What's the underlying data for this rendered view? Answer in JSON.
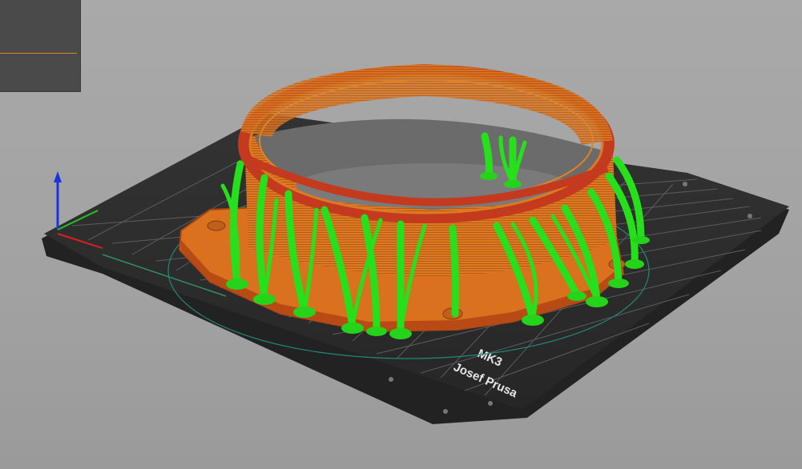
{
  "scene": {
    "bed_logo_line1": "MK3",
    "bed_logo_line2": "Josef Prusa"
  },
  "colors": {
    "background": "#a6a6a6",
    "bed": "#2c2c2c",
    "grid": "#5a5a5a",
    "model": "#d9771f",
    "model_shadow": "#c1451f",
    "support": "#25e01a",
    "axis_z": "#1c35d8",
    "axis_x": "#d82020",
    "axis_y": "#22c422",
    "legend_line": "#e0861f"
  }
}
